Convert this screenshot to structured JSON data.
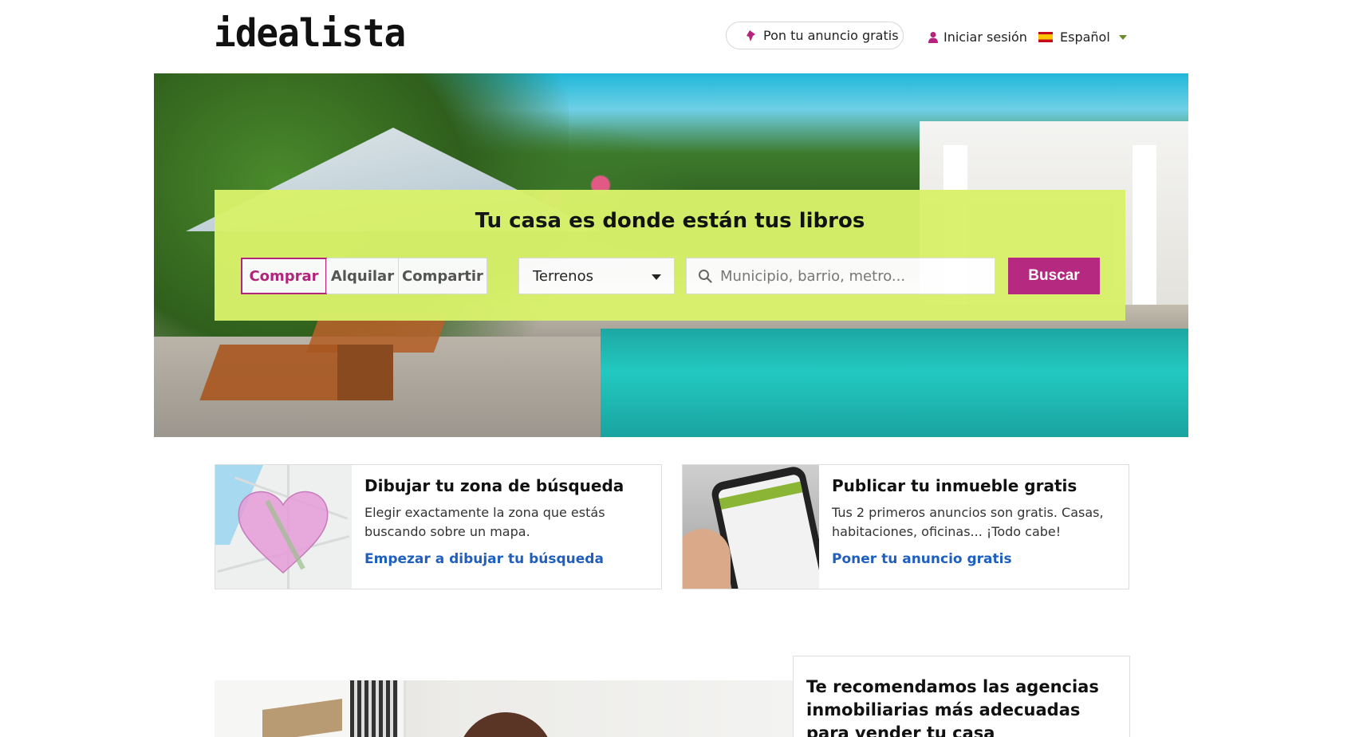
{
  "header": {
    "logo": "idealista",
    "publish_label": "Pon tu anuncio gratis",
    "login_label": "Iniciar sesión",
    "language_label": "Español"
  },
  "search": {
    "title": "Tu casa es donde están tus libros",
    "operations": [
      {
        "label": "Comprar",
        "active": true
      },
      {
        "label": "Alquilar",
        "active": false
      },
      {
        "label": "Compartir",
        "active": false
      }
    ],
    "property_type": "Terrenos",
    "location_placeholder": "Municipio, barrio, metro...",
    "submit_label": "Buscar"
  },
  "cards": [
    {
      "title": "Dibujar tu zona de búsqueda",
      "text": "Elegir exactamente la zona que estás buscando sobre un mapa.",
      "link": "Empezar a dibujar tu búsqueda"
    },
    {
      "title": "Publicar tu inmueble gratis",
      "text": "Tus 2 primeros anuncios son gratis. Casas, habitaciones, oficinas... ¡Todo cabe!",
      "link": "Poner tu anuncio gratis"
    }
  ],
  "promo": {
    "title": "Te recomendamos las agencias inmobiliarias más adecuadas para vender tu casa"
  },
  "colors": {
    "brand": "#b5237e",
    "search_panel": "#d8f16a",
    "link": "#1e5fbf"
  },
  "icons": {
    "publish": "pin-icon",
    "login": "user-icon",
    "language": "spain-flag-icon",
    "search": "search-icon"
  }
}
